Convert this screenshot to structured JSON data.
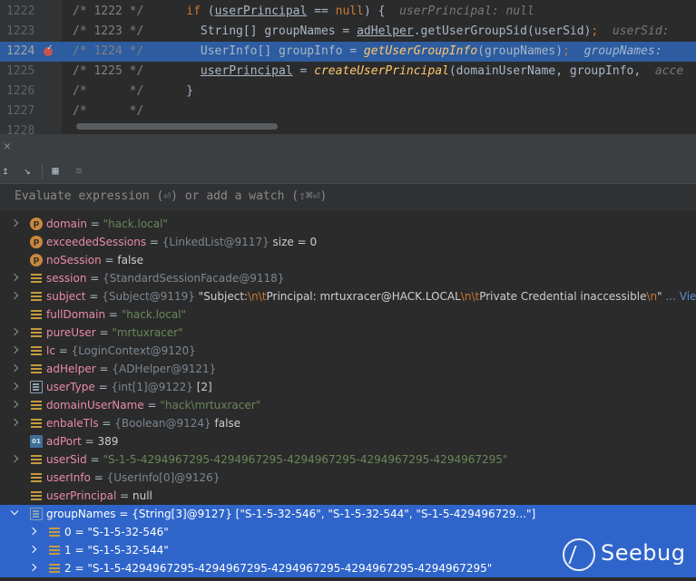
{
  "editor": {
    "lines": [
      {
        "num": "1222",
        "prefix": "/* 1222 */",
        "highlighted": false,
        "breakpoint": false,
        "tokens": [
          {
            "t": "      ",
            "c": ""
          },
          {
            "t": "if",
            "c": "kw"
          },
          {
            "t": " (",
            "c": ""
          },
          {
            "t": "userPrincipal",
            "c": "ul"
          },
          {
            "t": " == ",
            "c": ""
          },
          {
            "t": "null",
            "c": "kw"
          },
          {
            "t": ") {  ",
            "c": ""
          },
          {
            "t": "userPrincipal: null",
            "c": "hint"
          }
        ]
      },
      {
        "num": "1223",
        "prefix": "/* 1223 */",
        "highlighted": false,
        "breakpoint": false,
        "tokens": [
          {
            "t": "        String[] groupNames = ",
            "c": ""
          },
          {
            "t": "adHelper",
            "c": "ul"
          },
          {
            "t": ".getUserGroupSid(userSid)",
            "c": ""
          },
          {
            "t": ";",
            "c": "kw"
          },
          {
            "t": "  ",
            "c": ""
          },
          {
            "t": "userSid: ",
            "c": "hint"
          }
        ]
      },
      {
        "num": "1224",
        "prefix": "/* 1224 */",
        "highlighted": true,
        "breakpoint": true,
        "tokens": [
          {
            "t": "        UserInfo[] groupInfo = ",
            "c": ""
          },
          {
            "t": "getUserGroupInfo",
            "c": "mth"
          },
          {
            "t": "(groupNames)",
            "c": ""
          },
          {
            "t": ";",
            "c": "kw"
          },
          {
            "t": "  ",
            "c": ""
          },
          {
            "t": "groupNames: ",
            "c": "hint"
          }
        ]
      },
      {
        "num": "1225",
        "prefix": "/* 1225 */",
        "highlighted": false,
        "breakpoint": false,
        "tokens": [
          {
            "t": "        ",
            "c": ""
          },
          {
            "t": "userPrincipal",
            "c": "ul"
          },
          {
            "t": " = ",
            "c": ""
          },
          {
            "t": "createUserPrincipal",
            "c": "mth"
          },
          {
            "t": "(domainUserName, groupInfo,  ",
            "c": ""
          },
          {
            "t": "acce",
            "c": "hint"
          }
        ]
      },
      {
        "num": "1226",
        "prefix": "/*      */",
        "highlighted": false,
        "breakpoint": false,
        "tokens": [
          {
            "t": "      }",
            "c": ""
          }
        ]
      },
      {
        "num": "1227",
        "prefix": "/*      */",
        "highlighted": false,
        "breakpoint": false,
        "tokens": []
      },
      {
        "num": "1228",
        "prefix": "",
        "highlighted": false,
        "breakpoint": false,
        "tokens": []
      }
    ]
  },
  "debugger": {
    "evaluate_placeholder": "Evaluate expression (⏎) or add a watch (⇧⌘⏎)",
    "variables": [
      {
        "expand": "closed",
        "icon": "p",
        "name": "domain",
        "parts": [
          {
            "t": " = ",
            "c": "op"
          },
          {
            "t": "\"hack.local\"",
            "c": "sv"
          }
        ]
      },
      {
        "expand": "none",
        "icon": "p",
        "name": "exceededSessions",
        "parts": [
          {
            "t": " = ",
            "c": "op"
          },
          {
            "t": "{LinkedList@9117}",
            "c": "ref"
          },
          {
            "t": "  size = 0",
            "c": "pl"
          }
        ]
      },
      {
        "expand": "none",
        "icon": "p",
        "name": "noSession",
        "parts": [
          {
            "t": " = ",
            "c": "op"
          },
          {
            "t": "false",
            "c": "pl"
          }
        ]
      },
      {
        "expand": "closed",
        "icon": "f",
        "name": "session",
        "parts": [
          {
            "t": " = ",
            "c": "op"
          },
          {
            "t": "{StandardSessionFacade@9118}",
            "c": "ref"
          }
        ]
      },
      {
        "expand": "closed",
        "icon": "f",
        "name": "subject",
        "parts": [
          {
            "t": " = ",
            "c": "op"
          },
          {
            "t": "{Subject@9119} ",
            "c": "ref"
          },
          {
            "t": "\"Subject:",
            "c": "pl"
          },
          {
            "t": "\\n\\t",
            "c": "esc"
          },
          {
            "t": "Principal: mrtuxracer@HACK.LOCAL",
            "c": "pl"
          },
          {
            "t": "\\n\\t",
            "c": "esc"
          },
          {
            "t": "Private Credential inaccessible",
            "c": "pl"
          },
          {
            "t": "\\n",
            "c": "esc"
          },
          {
            "t": "\"",
            "c": "pl"
          },
          {
            "t": " ... View",
            "c": "more"
          }
        ]
      },
      {
        "expand": "none",
        "icon": "f",
        "name": "fullDomain",
        "parts": [
          {
            "t": " = ",
            "c": "op"
          },
          {
            "t": "\"hack.local\"",
            "c": "sv"
          }
        ]
      },
      {
        "expand": "closed",
        "icon": "f",
        "name": "pureUser",
        "parts": [
          {
            "t": " = ",
            "c": "op"
          },
          {
            "t": "\"mrtuxracer\"",
            "c": "sv"
          }
        ]
      },
      {
        "expand": "closed",
        "icon": "f",
        "name": "lc",
        "parts": [
          {
            "t": " = ",
            "c": "op"
          },
          {
            "t": "{LoginContext@9120}",
            "c": "ref"
          }
        ]
      },
      {
        "expand": "closed",
        "icon": "f",
        "name": "adHelper",
        "parts": [
          {
            "t": " = ",
            "c": "op"
          },
          {
            "t": "{ADHelper@9121}",
            "c": "ref"
          }
        ]
      },
      {
        "expand": "closed",
        "icon": "arr",
        "name": "userType",
        "parts": [
          {
            "t": " = ",
            "c": "op"
          },
          {
            "t": "{int[1]@9122} ",
            "c": "ref"
          },
          {
            "t": "[2]",
            "c": "pl"
          }
        ]
      },
      {
        "expand": "closed",
        "icon": "f",
        "name": "domainUserName",
        "parts": [
          {
            "t": " = ",
            "c": "op"
          },
          {
            "t": "\"hack\\mrtuxracer\"",
            "c": "sv"
          }
        ]
      },
      {
        "expand": "closed",
        "icon": "f",
        "name": "enbaleTls",
        "parts": [
          {
            "t": " = ",
            "c": "op"
          },
          {
            "t": "{Boolean@9124} ",
            "c": "ref"
          },
          {
            "t": "false",
            "c": "pl"
          }
        ]
      },
      {
        "expand": "none",
        "icon": "prim",
        "name": "adPort",
        "parts": [
          {
            "t": " = ",
            "c": "op"
          },
          {
            "t": "389",
            "c": "pl"
          }
        ]
      },
      {
        "expand": "closed",
        "icon": "f",
        "name": "userSid",
        "parts": [
          {
            "t": " = ",
            "c": "op"
          },
          {
            "t": "\"S-1-5-4294967295-4294967295-4294967295-4294967295-4294967295\"",
            "c": "sv"
          }
        ]
      },
      {
        "expand": "none",
        "icon": "f",
        "name": "userInfo",
        "parts": [
          {
            "t": " = ",
            "c": "op"
          },
          {
            "t": "{UserInfo[0]@9126}",
            "c": "ref"
          }
        ]
      },
      {
        "expand": "none",
        "icon": "f",
        "name": "userPrincipal",
        "parts": [
          {
            "t": " = ",
            "c": "op"
          },
          {
            "t": "null",
            "c": "pl"
          }
        ]
      },
      {
        "expand": "open",
        "icon": "arr",
        "name": "groupNames",
        "selected": true,
        "parts": [
          {
            "t": " = ",
            "c": "op"
          },
          {
            "t": "{String[3]@9127} ",
            "c": "ref"
          },
          {
            "t": "[\"S-1-5-32-546\", \"S-1-5-32-544\", \"S-1-5-429496729...\"]",
            "c": "pl"
          }
        ]
      },
      {
        "expand": "closed",
        "icon": "f",
        "name": "0",
        "child": true,
        "selected": true,
        "parts": [
          {
            "t": " = ",
            "c": "op"
          },
          {
            "t": "\"S-1-5-32-546\"",
            "c": "sv"
          }
        ]
      },
      {
        "expand": "closed",
        "icon": "f",
        "name": "1",
        "child": true,
        "selected": true,
        "parts": [
          {
            "t": " = ",
            "c": "op"
          },
          {
            "t": "\"S-1-5-32-544\"",
            "c": "sv"
          }
        ]
      },
      {
        "expand": "closed",
        "icon": "f",
        "name": "2",
        "child": true,
        "selected": true,
        "parts": [
          {
            "t": " = ",
            "c": "op"
          },
          {
            "t": "\"S-1-5-4294967295-4294967295-4294967295-4294967295-4294967295\"",
            "c": "sv"
          }
        ]
      }
    ]
  },
  "watermark": {
    "text": "Seebug"
  }
}
